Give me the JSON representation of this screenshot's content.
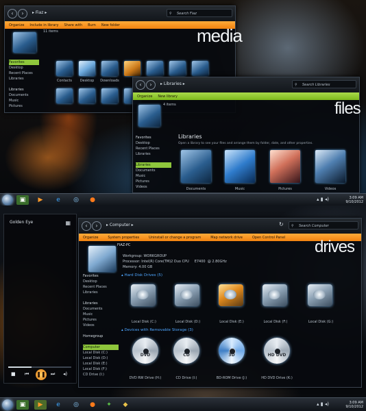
{
  "screen_top": {
    "media_window": {
      "address": "Fiaz",
      "search_placeholder": "Search Fiaz",
      "toolbar": [
        "Organize",
        "Include in library",
        "Share with",
        "Burn",
        "New folder"
      ],
      "item_count": "11 items",
      "watermark": "media",
      "nav": [
        "Favorites",
        "Desktop",
        "Recent Places",
        "Libraries",
        "",
        "Libraries",
        "Documents",
        "Music",
        "Pictures"
      ],
      "folders": [
        "Contacts",
        "Desktop",
        "Downloads",
        "",
        "",
        "",
        ""
      ]
    },
    "libraries_window": {
      "address": "Libraries",
      "search_placeholder": "Search Libraries",
      "toolbar": [
        "Organize",
        "New library"
      ],
      "item_count": "4 items",
      "watermark": "files",
      "nav": [
        "Favorites",
        "Desktop",
        "Recent Places",
        "Libraries",
        "",
        "Libraries",
        "Documents",
        "Music",
        "Pictures",
        "Videos"
      ],
      "heading": "Libraries",
      "subtitle": "Open a library to see your files and arrange them by folder, date, and other properties.",
      "libraries": [
        "Documents",
        "Music",
        "Pictures",
        "Videos"
      ]
    },
    "clock": {
      "time": "3:09 AM",
      "date": "9/10/2012"
    }
  },
  "screen_bottom": {
    "player": {
      "title": "Golden Eye",
      "controls": [
        "stop",
        "previous",
        "pause",
        "next",
        "volume"
      ]
    },
    "computer_window": {
      "address": "Computer",
      "search_placeholder": "Search Computer",
      "toolbar": [
        "Organize",
        "System properties",
        "Uninstall or change a program",
        "Map network drive",
        "Open Control Panel"
      ],
      "pc_name": "FIAZ-PC",
      "workgroup": "Workgroup: WORKGROUP",
      "processor": "Processor: Intel(R) Core(TM)2 Duo CPU     E7400  @ 2.80GHz",
      "memory": "Memory: 4.00 GB",
      "watermark": "drives",
      "hdd_section": "Hard Disk Drives (5)",
      "hdd": [
        "Local Disk (C:)",
        "Local Disk (D:)",
        "Local Disk (E:)",
        "Local Disk (F:)",
        "Local Disk (G:)"
      ],
      "removable_section": "Devices with Removable Storage (3)",
      "removable": [
        "DVD RW Drive (H:)",
        "CD Drive (I:)",
        "BD-ROM Drive (J:)",
        "HD DVD Drive (K:)"
      ],
      "disc_labels": [
        "DVD",
        "CD",
        "3D",
        "HD DVD"
      ],
      "nav": [
        "Favorites",
        "Desktop",
        "Recent Places",
        "Libraries",
        "",
        "Libraries",
        "Documents",
        "Music",
        "Pictures",
        "Videos",
        "",
        "Homegroup",
        "",
        "Computer",
        "Local Disk (C:)",
        "Local Disk (D:)",
        "Local Disk (E:)",
        "Local Disk (F:)",
        "CD Drive (I:)"
      ]
    },
    "clock": {
      "time": "3:09 AM",
      "date": "9/10/2012"
    }
  },
  "colors": {
    "orange_bar": "#f39321",
    "green_bar": "#8fc43a",
    "section_blue": "#4ea6ff"
  }
}
